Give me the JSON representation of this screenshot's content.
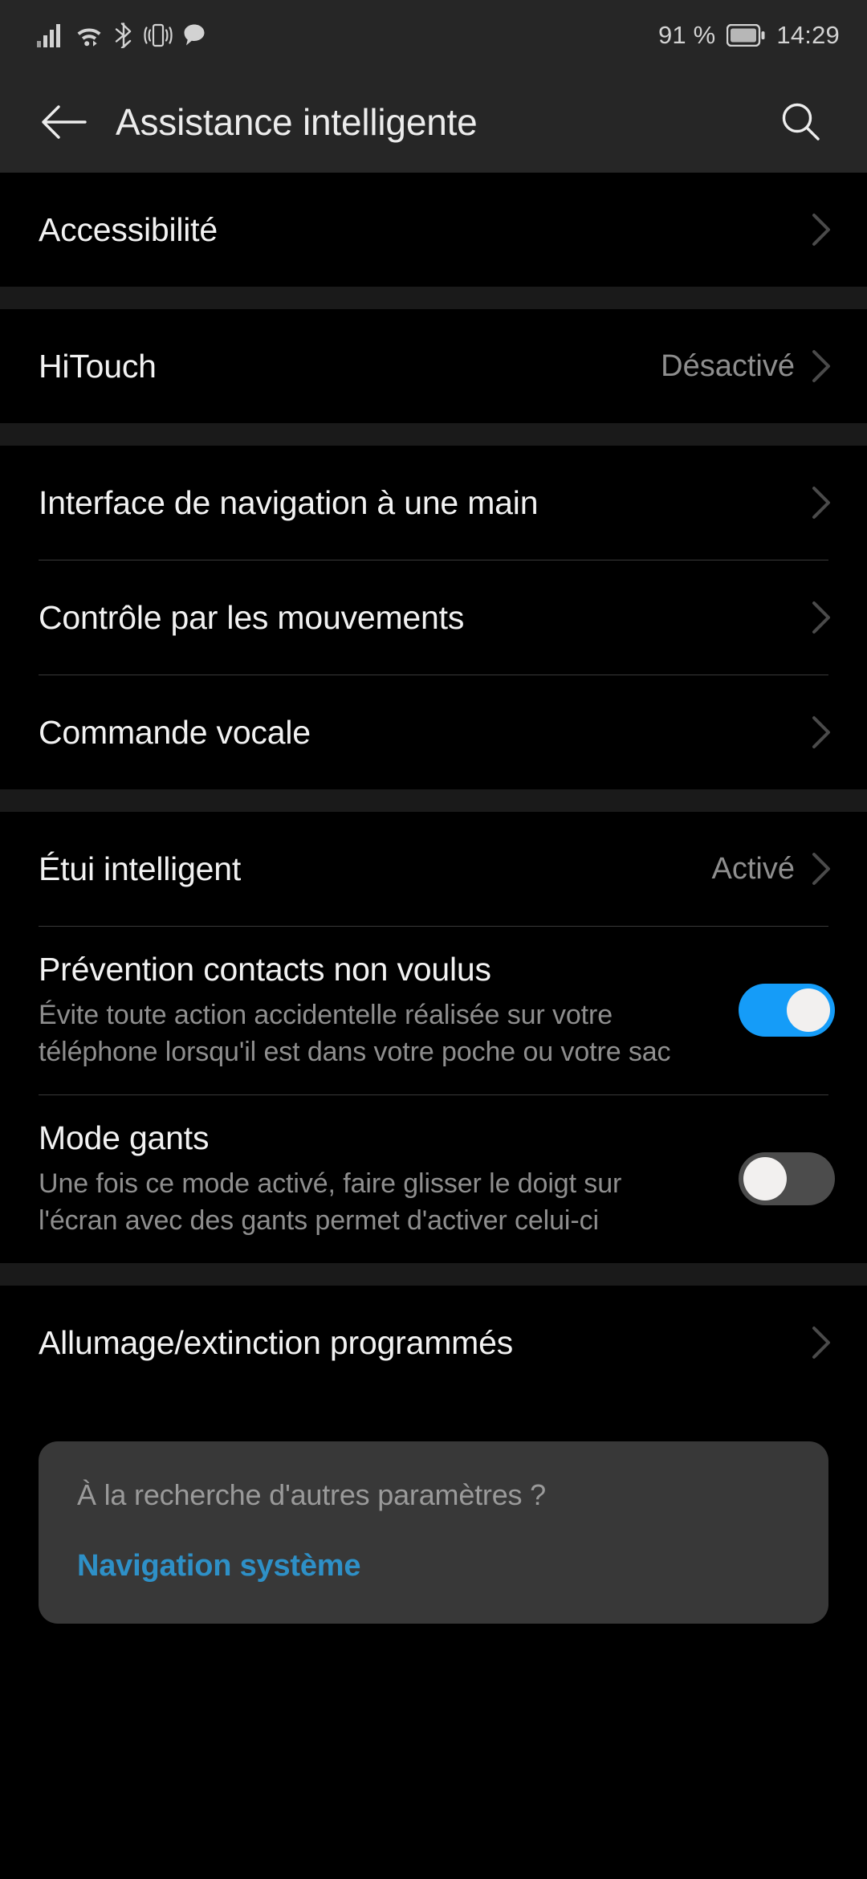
{
  "status_bar": {
    "icons": [
      "signal-bars-icon",
      "wifi-icon",
      "bluetooth-icon",
      "vibrate-icon",
      "message-bubble-icon"
    ],
    "battery_percent": "91 %",
    "battery_icon": "battery-icon",
    "time": "14:29"
  },
  "header": {
    "back_icon": "back-arrow-icon",
    "title": "Assistance intelligente",
    "search_icon": "search-icon"
  },
  "groups": [
    {
      "rows": [
        {
          "title": "Accessibilité",
          "value": "",
          "type": "chevron"
        }
      ]
    },
    {
      "rows": [
        {
          "title": "HiTouch",
          "value": "Désactivé",
          "type": "chevron"
        }
      ]
    },
    {
      "rows": [
        {
          "title": "Interface de navigation à une main",
          "value": "",
          "type": "chevron"
        },
        {
          "title": "Contrôle par les mouvements",
          "value": "",
          "type": "chevron"
        },
        {
          "title": "Commande vocale",
          "value": "",
          "type": "chevron"
        }
      ]
    },
    {
      "rows": [
        {
          "title": "Étui intelligent",
          "value": "Activé",
          "type": "chevron"
        },
        {
          "title": "Prévention contacts non voulus",
          "subtitle": "Évite toute action accidentelle réalisée sur votre téléphone lorsqu'il est dans votre poche ou votre sac",
          "type": "switch",
          "switch_state": "on"
        },
        {
          "title": "Mode gants",
          "subtitle": "Une fois ce mode activé, faire glisser le doigt sur l'écran avec des gants permet d'activer celui-ci",
          "type": "switch",
          "switch_state": "off"
        }
      ]
    },
    {
      "rows": [
        {
          "title": "Allumage/extinction programmés",
          "value": "",
          "type": "chevron"
        }
      ]
    }
  ],
  "suggestion_card": {
    "question": "À la recherche d'autres paramètres ?",
    "link": "Navigation système"
  },
  "colors": {
    "accent_blue": "#159cf8",
    "link_blue": "#2e90c7",
    "background": "#000000",
    "header_bg": "#262626",
    "card_bg": "#383838"
  }
}
